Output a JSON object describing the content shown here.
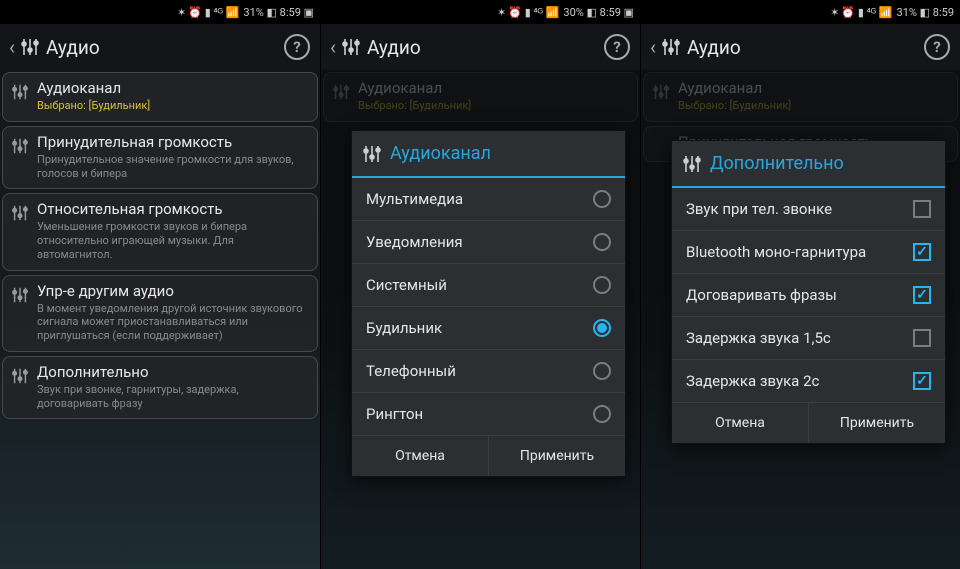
{
  "status": {
    "s1": "31% ◧ 8:59   ▣",
    "s2": "30% ◧ 8:59   ▣",
    "s3": "31% ◧ 8:59"
  },
  "header": {
    "title": "Аудио",
    "help": "?"
  },
  "cards": [
    {
      "title": "Аудиоканал",
      "sub": "Выбрано: [Будильник]",
      "subClass": "yellow"
    },
    {
      "title": "Принудительная громкость",
      "sub": "Принудительное значение громкости для звуков, голосов и бипера"
    },
    {
      "title": "Относительная громкость",
      "sub": "Уменьшение громкости звуков и бипера относительно играющей музыки. Для автомагнитол."
    },
    {
      "title": "Упр-е другим аудио",
      "sub": "В момент уведомления другой источник звукового сигнала может приостанавливаться или приглушаться (если поддерживает)"
    },
    {
      "title": "Дополнительно",
      "sub": "Звук при звонке, гарнитуры, задержка, договаривать фразу"
    }
  ],
  "dialog1": {
    "title": "Аудиоканал",
    "options": [
      {
        "label": "Мультимедиа",
        "selected": false
      },
      {
        "label": "Уведомления",
        "selected": false
      },
      {
        "label": "Системный",
        "selected": false
      },
      {
        "label": "Будильник",
        "selected": true
      },
      {
        "label": "Телефонный",
        "selected": false
      },
      {
        "label": "Рингтон",
        "selected": false
      }
    ],
    "cancel": "Отмена",
    "apply": "Применить"
  },
  "dialog2": {
    "title": "Дополнительно",
    "options": [
      {
        "label": "Звук при тел. звонке",
        "checked": false
      },
      {
        "label": "Bluetooth моно-гарнитура",
        "checked": true
      },
      {
        "label": "Договаривать фразы",
        "checked": true
      },
      {
        "label": "Задержка звука 1,5с",
        "checked": false
      },
      {
        "label": "Задержка звука 2с",
        "checked": true
      }
    ],
    "cancel": "Отмена",
    "apply": "Применить"
  }
}
